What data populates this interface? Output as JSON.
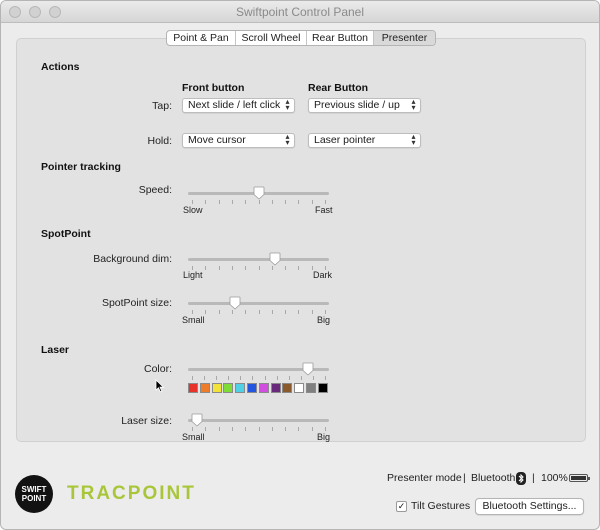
{
  "window": {
    "title": "Swiftpoint Control Panel"
  },
  "tabs": [
    {
      "label": "Point & Pan",
      "active": false
    },
    {
      "label": "Scroll Wheel",
      "active": false
    },
    {
      "label": "Rear Button",
      "active": false
    },
    {
      "label": "Presenter",
      "active": true
    }
  ],
  "actions": {
    "heading": "Actions",
    "front_header": "Front button",
    "rear_header": "Rear Button",
    "tap_label": "Tap:",
    "hold_label": "Hold:",
    "tap_front": "Next slide / left click",
    "tap_rear": "Previous slide / up",
    "hold_front": "Move cursor",
    "hold_rear": "Laser pointer"
  },
  "pointer_tracking": {
    "heading": "Pointer tracking",
    "speed_label": "Speed:",
    "speed_min": "Slow",
    "speed_max": "Fast",
    "speed_value": 0.5
  },
  "spotpoint": {
    "heading": "SpotPoint",
    "dim_label": "Background dim:",
    "dim_min": "Light",
    "dim_max": "Dark",
    "dim_value": 0.63,
    "size_label": "SpotPoint size:",
    "size_min": "Small",
    "size_max": "Big",
    "size_value": 0.32
  },
  "laser": {
    "heading": "Laser",
    "color_label": "Color:",
    "color_value": 0.88,
    "colors": [
      "#e8332a",
      "#ee7d2a",
      "#f1e33a",
      "#7ddc36",
      "#4fd0e4",
      "#2356e0",
      "#d04fe0",
      "#6a2a7c",
      "#8a5a2c",
      "#ffffff",
      "#7f7f7f",
      "#000000"
    ],
    "size_label": "Laser size:",
    "size_min": "Small",
    "size_max": "Big",
    "size_value": 0.02
  },
  "footer": {
    "logo_line1": "SWIFT",
    "logo_line2": "POINT",
    "brand": "TRACPOINT",
    "mode": "Presenter mode",
    "sep1": "|",
    "connection": "Bluetooth",
    "sep2": "|",
    "battery_text": "100%",
    "battery_level": 1.0,
    "tilt_label": "Tilt Gestures",
    "tilt_checked": true,
    "bt_settings_label": "Bluetooth Settings..."
  }
}
